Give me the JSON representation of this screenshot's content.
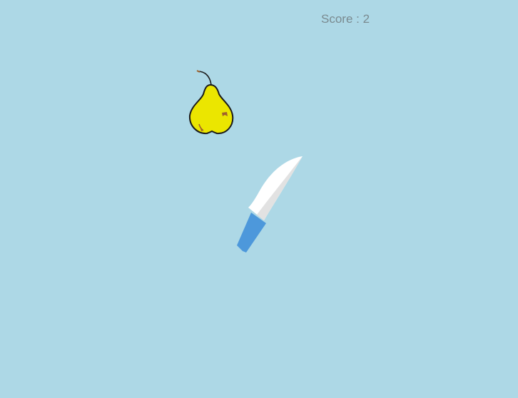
{
  "game": {
    "score_label": "Score : 2"
  },
  "objects": {
    "fruit": "pear-icon",
    "blade": "knife-icon"
  },
  "colors": {
    "background": "#add8e6",
    "score_text": "#7a8a8f",
    "pear_body": "#ebe600",
    "pear_outline": "#1a1a1a",
    "pear_spot": "#a0622d",
    "knife_blade": "#ffffff",
    "knife_blade_shade": "#e2e2e2",
    "knife_handle": "#4d98db"
  }
}
